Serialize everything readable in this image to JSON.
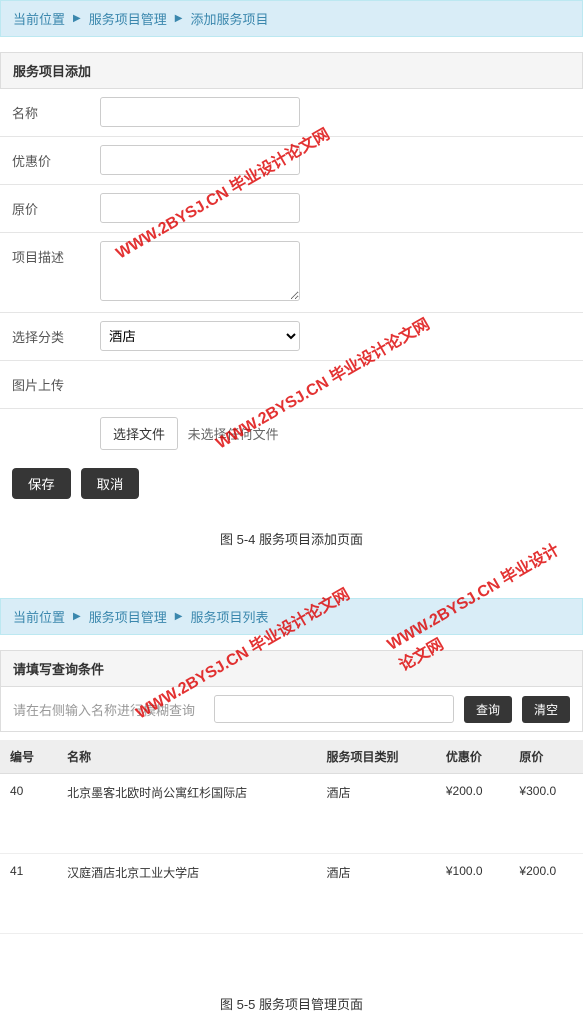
{
  "section1": {
    "breadcrumb": {
      "current": "当前位置",
      "link1": "服务项目管理",
      "link2": "添加服务项目"
    },
    "panel_title": "服务项目添加",
    "form": {
      "name_label": "名称",
      "name_value": "",
      "discount_label": "优惠价",
      "discount_value": "",
      "original_label": "原价",
      "original_value": "",
      "desc_label": "项目描述",
      "desc_value": "",
      "category_label": "选择分类",
      "category_value": "酒店",
      "upload_label": "图片上传",
      "file_btn": "选择文件",
      "file_text": "未选择任何文件",
      "save_btn": "保存",
      "cancel_btn": "取消"
    },
    "caption": "图 5-4 服务项目添加页面"
  },
  "section2": {
    "breadcrumb": {
      "current": "当前位置",
      "link1": "服务项目管理",
      "link2": "服务项目列表"
    },
    "search": {
      "title": "请填写查询条件",
      "hint": "请在右侧输入名称进行模糊查询",
      "value": "",
      "query_btn": "查询",
      "clear_btn": "清空"
    },
    "table": {
      "headers": {
        "id": "编号",
        "name": "名称",
        "category": "服务项目类别",
        "discount": "优惠价",
        "original": "原价"
      },
      "rows": [
        {
          "id": "40",
          "name": "北京墨客北欧时尚公寓红杉国际店",
          "category": "酒店",
          "discount": "¥200.0",
          "original": "¥300.0"
        },
        {
          "id": "41",
          "name": "汉庭酒店北京工业大学店",
          "category": "酒店",
          "discount": "¥100.0",
          "original": "¥200.0"
        }
      ]
    },
    "caption": "图 5-5 服务项目管理页面"
  },
  "watermark": "WWW.2BYSJ.CN 毕业设计论文网"
}
